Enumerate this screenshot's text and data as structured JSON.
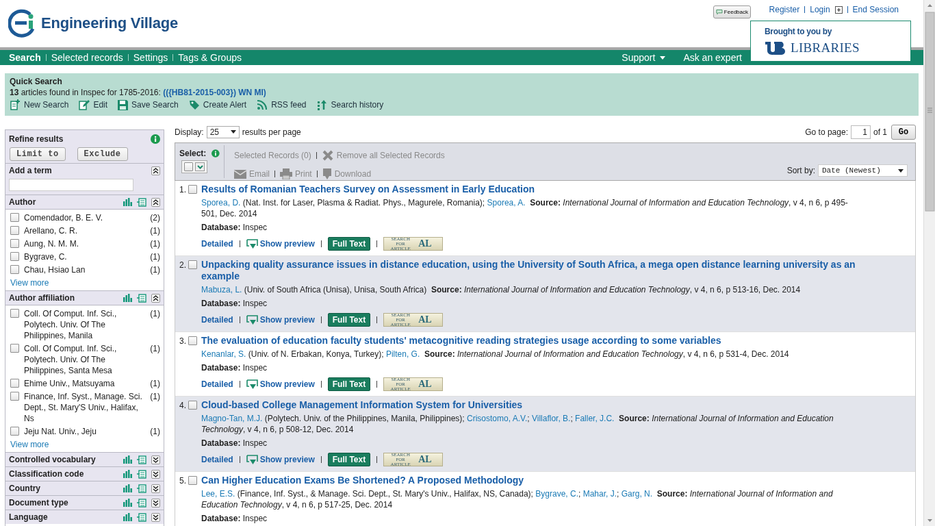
{
  "header": {
    "logo_text": "Engineering Village",
    "feedback": "Feedback",
    "links": [
      {
        "label": "Register",
        "kind": "link"
      },
      {
        "label": "Login",
        "kind": "login"
      },
      {
        "label": "End Session",
        "kind": "link"
      }
    ],
    "sponsor": {
      "caption": "Brought to you by",
      "library": "LIBRARIES"
    }
  },
  "nav": {
    "items": [
      {
        "label": "Search",
        "selected": true
      },
      {
        "label": "Selected records",
        "selected": false
      },
      {
        "label": "Settings",
        "selected": false
      },
      {
        "label": "Tags & Groups",
        "selected": false
      }
    ],
    "right": [
      {
        "label": "Support",
        "kind": "dropdown"
      },
      {
        "label": "Ask an expert",
        "kind": "link"
      }
    ]
  },
  "quick_search": {
    "title": "Quick Search",
    "summary": "**13** articles found in Inspec for 1785-2016:",
    "query": "(({HB81-2015-003}) WN MI)",
    "actions": [
      {
        "label": "New Search",
        "kind": "new"
      },
      {
        "label": "Edit",
        "kind": "edit"
      },
      {
        "label": "Save Search",
        "kind": "save"
      },
      {
        "label": "Create Alert",
        "kind": "alert"
      },
      {
        "label": "RSS feed",
        "kind": "rss"
      },
      {
        "label": "Search history",
        "kind": "history"
      }
    ]
  },
  "sidebar": {
    "title": "Refine results",
    "buttons": [
      "Limit to",
      "Exclude"
    ],
    "sections": [
      {
        "kind": "term",
        "title": "Add a term",
        "expanded": true
      },
      {
        "kind": "facet",
        "title": "Author",
        "expanded": true,
        "more": "View more",
        "items": [
          {
            "label": "Comendador, B. E. V.",
            "count": "(2)",
            "checked": false
          },
          {
            "label": "Arellano, C. R.",
            "count": "(1)",
            "checked": false
          },
          {
            "label": "Aung, N. M. M.",
            "count": "(1)",
            "checked": false
          },
          {
            "label": "Bygrave, C.",
            "count": "(1)",
            "checked": false
          },
          {
            "label": "Chau, Hsiao Lan",
            "count": "(1)",
            "checked": false
          }
        ]
      },
      {
        "kind": "facet",
        "title": "Author affiliation",
        "expanded": true,
        "more": "View more",
        "items": [
          {
            "label": "Coll. Of Comput. Inf. Sci., Polytech. Univ. Of The Philippines, Manila",
            "count": "(1)",
            "checked": false
          },
          {
            "label": "Coll. Of Comput. Inf. Sci., Polytech. Univ. Of The Philippines, Santa Mesa",
            "count": "(1)",
            "checked": false
          },
          {
            "label": "Ehime Univ., Matsuyama",
            "count": "(1)",
            "checked": false
          },
          {
            "label": "Finance, Inf. Syst., Manage. Sci. Dept., St. Mary'S Univ., Halifax, Ns",
            "count": "(1)",
            "checked": false
          },
          {
            "label": "Jeju Nat. Univ., Jeju",
            "count": "(1)",
            "checked": false
          }
        ]
      },
      {
        "kind": "facet",
        "title": "Controlled vocabulary",
        "expanded": false
      },
      {
        "kind": "facet",
        "title": "Classification code",
        "expanded": false
      },
      {
        "kind": "facet",
        "title": "Country",
        "expanded": false
      },
      {
        "kind": "facet",
        "title": "Document type",
        "expanded": false
      },
      {
        "kind": "facet",
        "title": "Language",
        "expanded": false
      }
    ]
  },
  "results_bar": {
    "display_label": "Display:",
    "per_page": "25",
    "per_page_suffix": "results per page",
    "goto_label": "Go to page:",
    "page": "1",
    "page_of": "of 1",
    "go": "Go"
  },
  "toolbar": {
    "select_label": "Select:",
    "select_all_checked": false,
    "actions": [
      {
        "label": "Selected Records (0)",
        "kind": "count",
        "disabled": true
      },
      {
        "label": "Remove all Selected Records",
        "kind": "remove",
        "disabled": true
      }
    ],
    "outputs": [
      {
        "label": "Email",
        "kind": "email",
        "disabled": true
      },
      {
        "label": "Print",
        "kind": "print",
        "disabled": true
      },
      {
        "label": "Download",
        "kind": "download",
        "disabled": true
      }
    ],
    "sort_label": "Sort by:",
    "sort": "Date (Newest)"
  },
  "results": [
    {
      "number": "1.",
      "checked": false,
      "title": "Results of Romanian Teachers Survey on Assessment in Early Education",
      "authors": [
        {
          "name": "Sporea, D.",
          "note": "(Nat. Inst. for Laser, Plasma & Radiat. Phys., Magurele, Romania);"
        },
        {
          "name": "Sporea, A."
        }
      ],
      "source": "**Source:** *International Journal of Information and Education Technology*, v 4, n 6, p 495-501, Dec. 2014",
      "database": "**Database:** Inspec",
      "actions": [
        {
          "kind": "link",
          "label": "Detailed"
        },
        {
          "kind": "preview",
          "label": "Show preview"
        },
        {
          "kind": "fulltext",
          "label": "Full Text"
        },
        {
          "kind": "article",
          "label": "SEARCH FOR ARTICLE",
          "mark": "AL"
        }
      ]
    },
    {
      "number": "2.",
      "checked": false,
      "title": "Unpacking quality assurance issues in distance education, using the University of South Africa, a mega open distance learning university as an example",
      "authors": [
        {
          "name": "Mabuza, L.",
          "note": "(Univ. of South Africa (Unisa), Unisa, South Africa)"
        }
      ],
      "source": "**Source:** *International Journal of Information and Education Technology*, v 4, n 6, p 513-16, Dec. 2014",
      "database": "**Database:** Inspec",
      "actions": [
        {
          "kind": "link",
          "label": "Detailed"
        },
        {
          "kind": "preview",
          "label": "Show preview"
        },
        {
          "kind": "fulltext",
          "label": "Full Text"
        },
        {
          "kind": "article",
          "label": "SEARCH FOR ARTICLE",
          "mark": "AL"
        }
      ]
    },
    {
      "number": "3.",
      "checked": false,
      "title": "The evaluation of education faculty students' metacognitive reading strategies usage according to some variables",
      "authors": [
        {
          "name": "Kenanlar, S.",
          "note": "(Univ. of N. Erbakan, Konya, Turkey);"
        },
        {
          "name": "Pilten, G."
        }
      ],
      "source": "**Source:** *International Journal of Information and Education Technology*, v 4, n 6, p 531-4, Dec. 2014",
      "database": "**Database:** Inspec",
      "actions": [
        {
          "kind": "link",
          "label": "Detailed"
        },
        {
          "kind": "preview",
          "label": "Show preview"
        },
        {
          "kind": "fulltext",
          "label": "Full Text"
        },
        {
          "kind": "article",
          "label": "SEARCH FOR ARTICLE",
          "mark": "AL"
        }
      ]
    },
    {
      "number": "4.",
      "checked": false,
      "title": "Cloud-based College Management Information System for Universities",
      "authors": [
        {
          "name": "Magno-Tan, M.J.",
          "note": "(Polytech. Univ. of the Philippines, Manila, Philippines);"
        },
        {
          "name": "Crisostomo, A.V.",
          "note": ";"
        },
        {
          "name": "Villaflor, B.",
          "note": ";"
        },
        {
          "name": "Faller, J.C."
        }
      ],
      "source": "**Source:** *International Journal of Information and Education Technology*, v 4, n 6, p 508-12, Dec. 2014",
      "database": "**Database:** Inspec",
      "actions": [
        {
          "kind": "link",
          "label": "Detailed"
        },
        {
          "kind": "preview",
          "label": "Show preview"
        },
        {
          "kind": "fulltext",
          "label": "Full Text"
        },
        {
          "kind": "article",
          "label": "SEARCH FOR ARTICLE",
          "mark": "AL"
        }
      ]
    },
    {
      "number": "5.",
      "checked": false,
      "title": "Can Higher Education Exams Be Shortened? A Proposed Methodology",
      "authors": [
        {
          "name": "Lee, E.S.",
          "note": "(Finance, Inf. Syst., & Manage. Sci. Dept., St. Mary's Univ., Halifax, NS, Canada);"
        },
        {
          "name": "Bygrave, C.",
          "note": ";"
        },
        {
          "name": "Mahar, J.",
          "note": ";"
        },
        {
          "name": "Garg, N."
        }
      ],
      "source": "**Source:** *International Journal of Information and Education Technology*, v 4, n 6, p 517-25, Dec. 2014",
      "database": "**Database:** Inspec"
    }
  ]
}
